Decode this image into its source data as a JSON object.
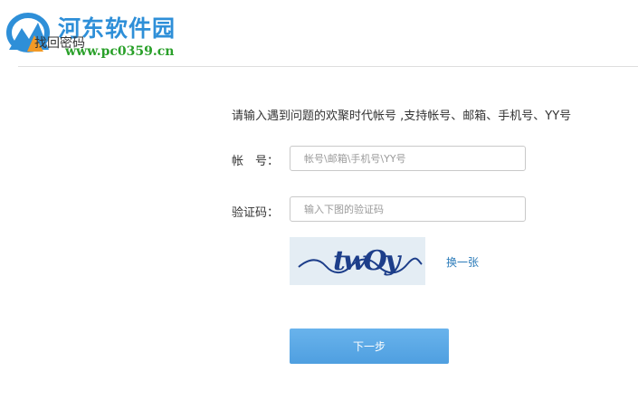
{
  "watermark": {
    "site_name": "河东软件园",
    "url": "www.pc0359.cn"
  },
  "header": {
    "title": "找回密码"
  },
  "form": {
    "intro": "请输入遇到问题的欢聚时代帐号 ,支持帐号、邮箱、手机号、YY号",
    "account_label": "帐　号：",
    "account_placeholder": "帐号\\邮箱\\手机号\\YY号",
    "captcha_label": "验证码：",
    "captcha_placeholder": "输入下图的验证码",
    "captcha_text": "twOy",
    "refresh_label": "换一张",
    "next_button": "下一步"
  },
  "colors": {
    "accent": "#4f9fe0",
    "link": "#2b7bb9",
    "watermark_title": "#2e8fd8",
    "watermark_url": "#2aa02a"
  }
}
